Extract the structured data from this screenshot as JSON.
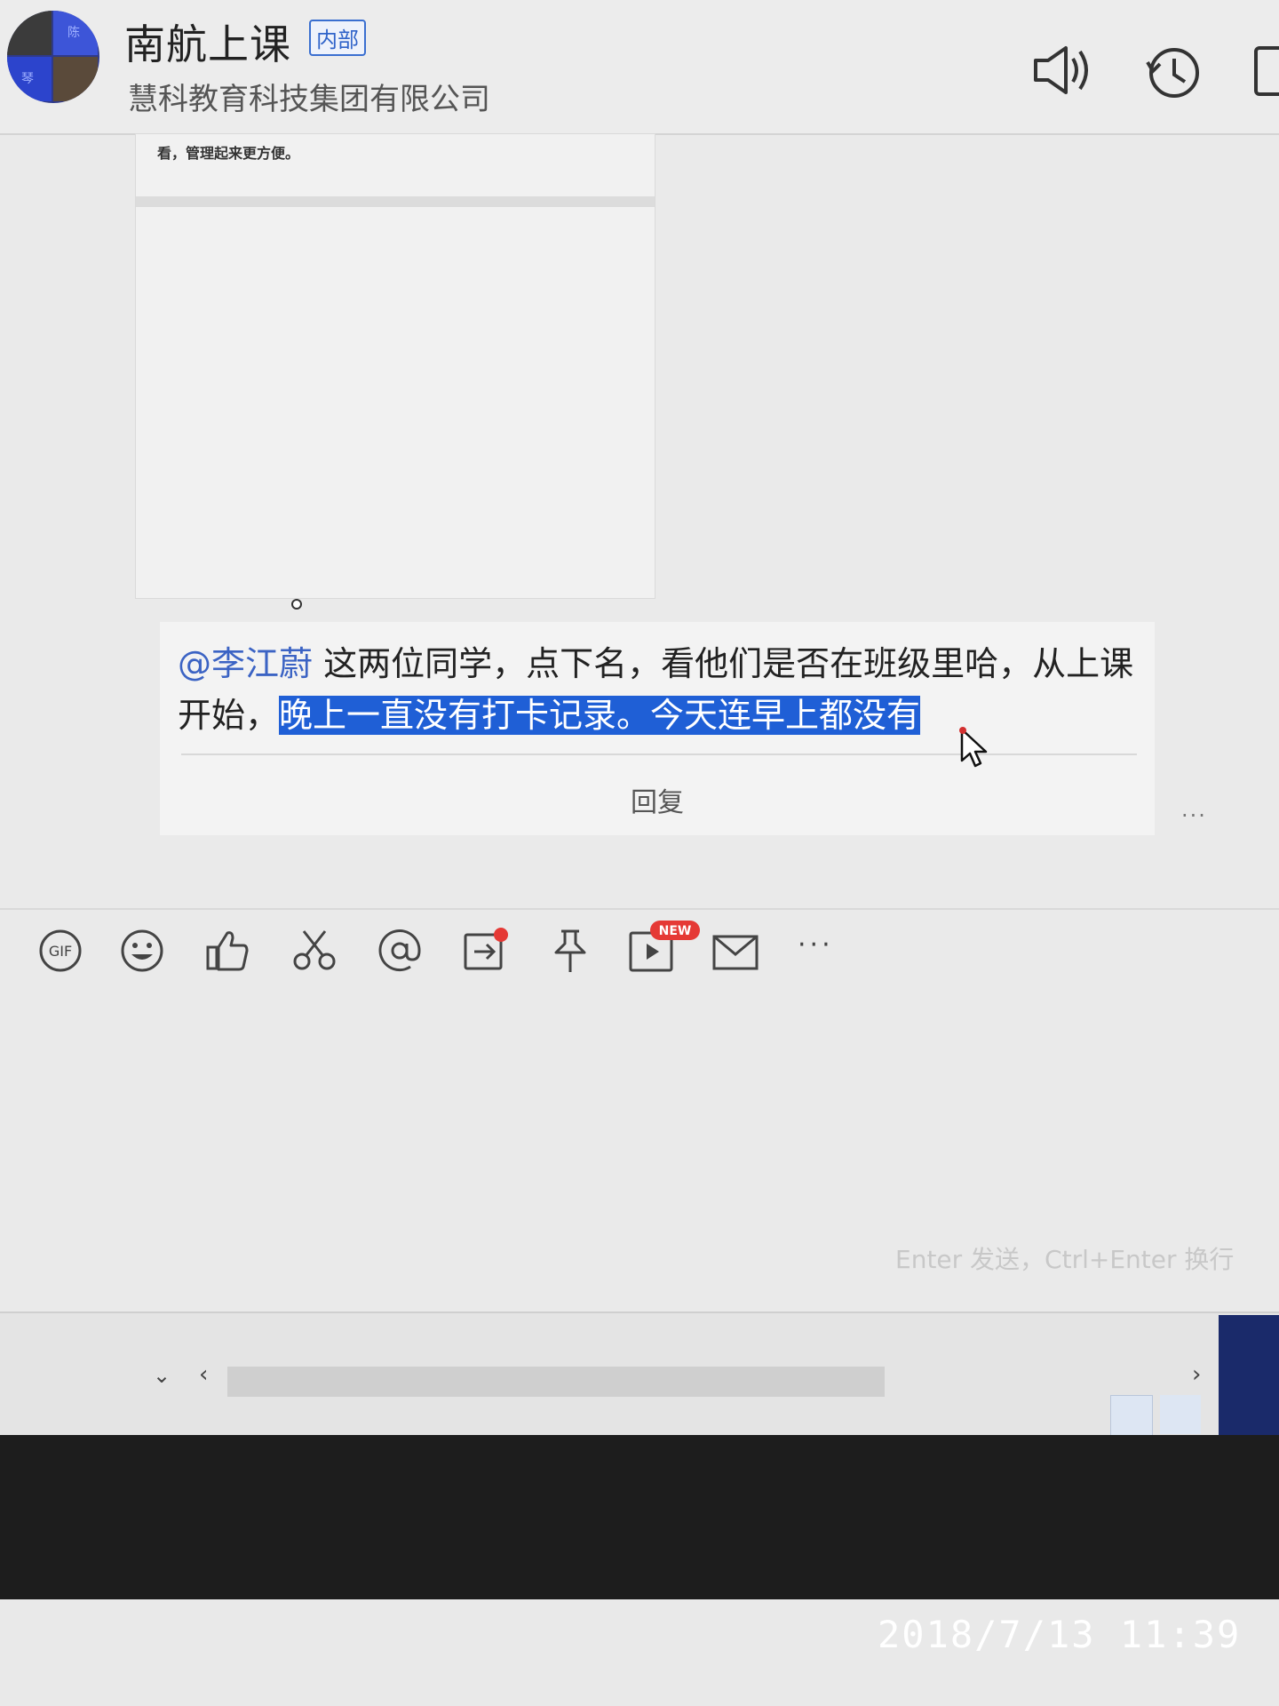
{
  "header": {
    "title": "南航上课",
    "badge": "内部",
    "subtitle": "慧科教育科技集团有限公司",
    "avatar_text": [
      "陈",
      "琴"
    ]
  },
  "chat": {
    "image_caption": "看，管理起来更方便。",
    "message": {
      "mention": "@李江蔚",
      "text_plain": " 这两位同学，点下名，看他们是否在班级里哈，从上课开始，",
      "text_highlighted": "晚上一直没有打卡记录。今天连早上都没有"
    },
    "reply_label": "回复",
    "more_label": "···"
  },
  "toolbar": {
    "items": [
      "gif-icon",
      "emoji-icon",
      "thumbs-up-icon",
      "scissors-icon",
      "at-icon",
      "share-icon",
      "pin-icon",
      "screen-record-icon",
      "mail-icon",
      "more-icon"
    ],
    "gif_label": "GIF",
    "new_badge": "NEW",
    "more_label": "···"
  },
  "input": {
    "hint": "Enter 发送，Ctrl+Enter 换行"
  },
  "overlay": {
    "timestamp": "2018/7/13  11:39"
  },
  "colors": {
    "accent_blue": "#1f5fd6",
    "mention_blue": "#3b63c4",
    "badge_red": "#e53935"
  }
}
